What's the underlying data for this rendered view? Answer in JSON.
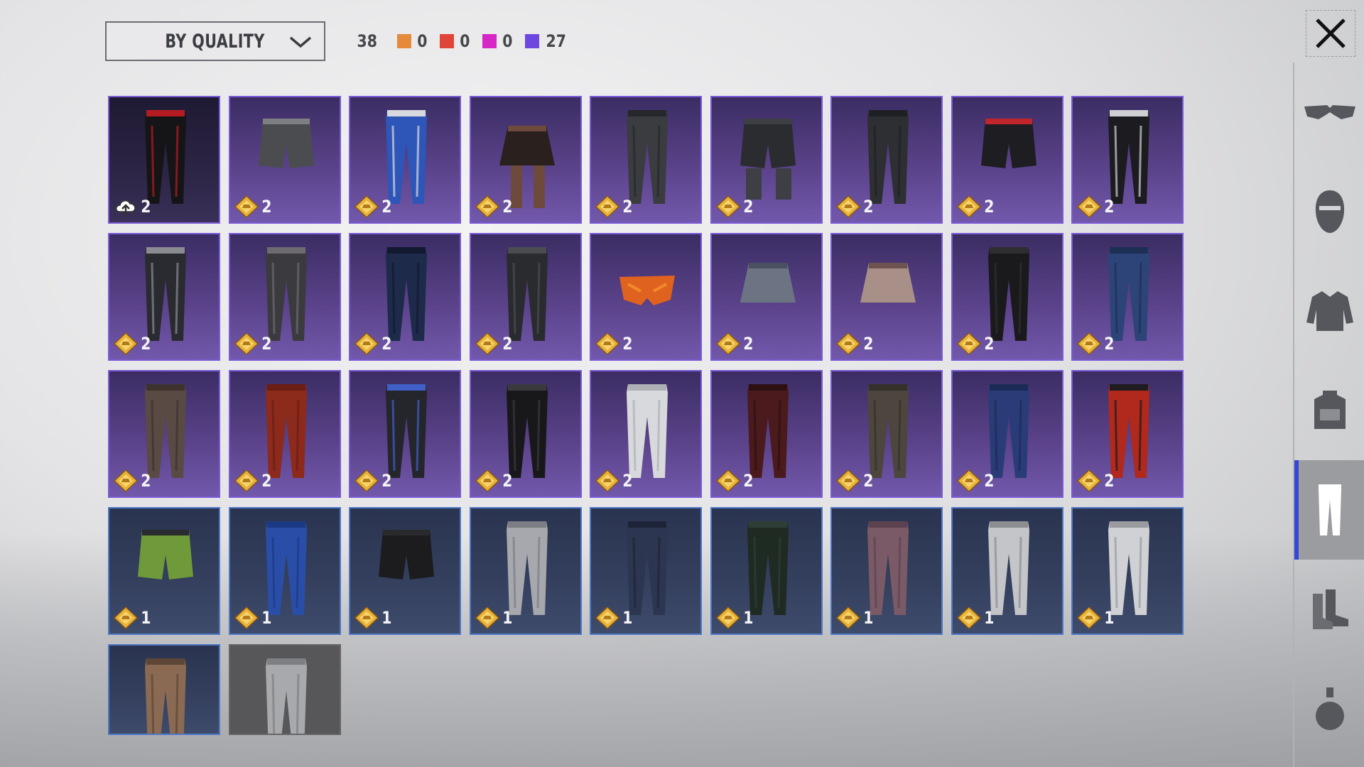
{
  "header": {
    "sort_label": "BY QUALITY",
    "total_count": "38",
    "rarity_counts": [
      {
        "name": "legendary",
        "color": "#e5893a",
        "count": "0"
      },
      {
        "name": "mythic",
        "color": "#e0453a",
        "count": "0"
      },
      {
        "name": "pink",
        "color": "#d726c6",
        "count": "0"
      },
      {
        "name": "epic",
        "color": "#6e46e0",
        "count": "27"
      }
    ]
  },
  "sidebar": {
    "categories": [
      {
        "name": "glasses",
        "icon": "glasses-icon",
        "active": false
      },
      {
        "name": "mask",
        "icon": "mask-icon",
        "active": false
      },
      {
        "name": "top",
        "icon": "jacket-icon",
        "active": false
      },
      {
        "name": "backpack",
        "icon": "backpack-icon",
        "active": false
      },
      {
        "name": "pants",
        "icon": "pants-icon",
        "active": true
      },
      {
        "name": "shoes",
        "icon": "boots-icon",
        "active": false
      },
      {
        "name": "emote",
        "icon": "grenade-icon",
        "active": false
      }
    ]
  },
  "items": [
    {
      "type": "pants",
      "rarity": "epic",
      "qty": "2",
      "colors": [
        "#151518",
        "#b41c22"
      ],
      "cloud": true,
      "style": "dark"
    },
    {
      "type": "shorts",
      "rarity": "epic",
      "qty": "2",
      "colors": [
        "#4a4c50",
        "#7d7f84"
      ]
    },
    {
      "type": "pants",
      "rarity": "epic",
      "qty": "2",
      "colors": [
        "#2e55b8",
        "#d8d9de"
      ]
    },
    {
      "type": "skirt-stockings",
      "rarity": "epic",
      "qty": "2",
      "colors": [
        "#2a211f",
        "#6e4a3c"
      ]
    },
    {
      "type": "pants",
      "rarity": "epic",
      "qty": "2",
      "colors": [
        "#3a3c40",
        "#25272a"
      ]
    },
    {
      "type": "shorts-boots",
      "rarity": "epic",
      "qty": "2",
      "colors": [
        "#2b2c30",
        "#3e3f44"
      ]
    },
    {
      "type": "pants",
      "rarity": "epic",
      "qty": "2",
      "colors": [
        "#2d2f33",
        "#1e2023"
      ]
    },
    {
      "type": "shorts",
      "rarity": "epic",
      "qty": "2",
      "colors": [
        "#1e1e22",
        "#c0252b"
      ]
    },
    {
      "type": "pants",
      "rarity": "epic",
      "qty": "2",
      "colors": [
        "#1c1c20",
        "#cfd0d4"
      ]
    },
    {
      "type": "pants",
      "rarity": "epic",
      "qty": "2",
      "colors": [
        "#2a2b30",
        "#8a8c92"
      ]
    },
    {
      "type": "pants",
      "rarity": "epic",
      "qty": "2",
      "colors": [
        "#3b3a3e",
        "#6d6b70"
      ]
    },
    {
      "type": "pants",
      "rarity": "epic",
      "qty": "2",
      "colors": [
        "#1e2a4a",
        "#111a30"
      ]
    },
    {
      "type": "pants",
      "rarity": "epic",
      "qty": "2",
      "colors": [
        "#2a2b2f",
        "#4a4c52"
      ]
    },
    {
      "type": "briefs",
      "rarity": "epic",
      "qty": "2",
      "colors": [
        "#e0621f",
        "#f08a2a"
      ]
    },
    {
      "type": "skirt",
      "rarity": "epic",
      "qty": "2",
      "colors": [
        "#6c7484",
        "#4a5060"
      ]
    },
    {
      "type": "skirt",
      "rarity": "epic",
      "qty": "2",
      "colors": [
        "#a88f87",
        "#6e5450"
      ]
    },
    {
      "type": "pants",
      "rarity": "epic",
      "qty": "2",
      "colors": [
        "#1a1a1c",
        "#2e2e31"
      ]
    },
    {
      "type": "pants",
      "rarity": "epic",
      "qty": "2",
      "colors": [
        "#2d4478",
        "#1e2f55"
      ]
    },
    {
      "type": "pants",
      "rarity": "epic",
      "qty": "2",
      "colors": [
        "#5a4a44",
        "#3d322e"
      ]
    },
    {
      "type": "pants",
      "rarity": "epic",
      "qty": "2",
      "colors": [
        "#8c2a1c",
        "#6a1e14"
      ]
    },
    {
      "type": "pants",
      "rarity": "epic",
      "qty": "2",
      "colors": [
        "#25262b",
        "#4060c8"
      ]
    },
    {
      "type": "pants",
      "rarity": "epic",
      "qty": "2",
      "colors": [
        "#18181a",
        "#3a3a3e"
      ]
    },
    {
      "type": "pants",
      "rarity": "epic",
      "qty": "2",
      "colors": [
        "#d8d9dc",
        "#aeb0b5"
      ]
    },
    {
      "type": "pants",
      "rarity": "epic",
      "qty": "2",
      "colors": [
        "#4a1a1c",
        "#2e1012"
      ]
    },
    {
      "type": "pants",
      "rarity": "epic",
      "qty": "2",
      "colors": [
        "#4c463e",
        "#35302a"
      ]
    },
    {
      "type": "pants",
      "rarity": "epic",
      "qty": "2",
      "colors": [
        "#2a3c78",
        "#1c2a58"
      ]
    },
    {
      "type": "pants",
      "rarity": "epic",
      "qty": "2",
      "colors": [
        "#b0291c",
        "#1e1c1e"
      ]
    },
    {
      "type": "shorts",
      "rarity": "rare",
      "qty": "1",
      "colors": [
        "#6e9a3a",
        "#2a2b2e"
      ]
    },
    {
      "type": "pants",
      "rarity": "rare",
      "qty": "1",
      "colors": [
        "#2a4ea8",
        "#1c3a84"
      ]
    },
    {
      "type": "shorts",
      "rarity": "rare",
      "qty": "1",
      "colors": [
        "#1c1c1e",
        "#2a2a2d"
      ]
    },
    {
      "type": "pants",
      "rarity": "rare",
      "qty": "1",
      "colors": [
        "#a6a8ad",
        "#7c7e83"
      ]
    },
    {
      "type": "pants",
      "rarity": "rare",
      "qty": "1",
      "colors": [
        "#2c3650",
        "#1e2438"
      ]
    },
    {
      "type": "pants",
      "rarity": "rare",
      "qty": "1",
      "colors": [
        "#1e2a22",
        "#2e3e34"
      ]
    },
    {
      "type": "pants",
      "rarity": "rare",
      "qty": "1",
      "colors": [
        "#7a5a66",
        "#5c4250"
      ]
    },
    {
      "type": "pants",
      "rarity": "rare",
      "qty": "1",
      "colors": [
        "#c4c5c8",
        "#8c8d91"
      ]
    },
    {
      "type": "pants",
      "rarity": "rare",
      "qty": "1",
      "colors": [
        "#d0d1d4",
        "#9a9b9f"
      ]
    },
    {
      "type": "pants",
      "rarity": "rare",
      "qty": "",
      "colors": [
        "#8a6a52",
        "#5e4636"
      ]
    },
    {
      "type": "pants",
      "rarity": "common",
      "qty": "",
      "colors": [
        "#a8a9ac",
        "#7e7f83"
      ]
    }
  ]
}
